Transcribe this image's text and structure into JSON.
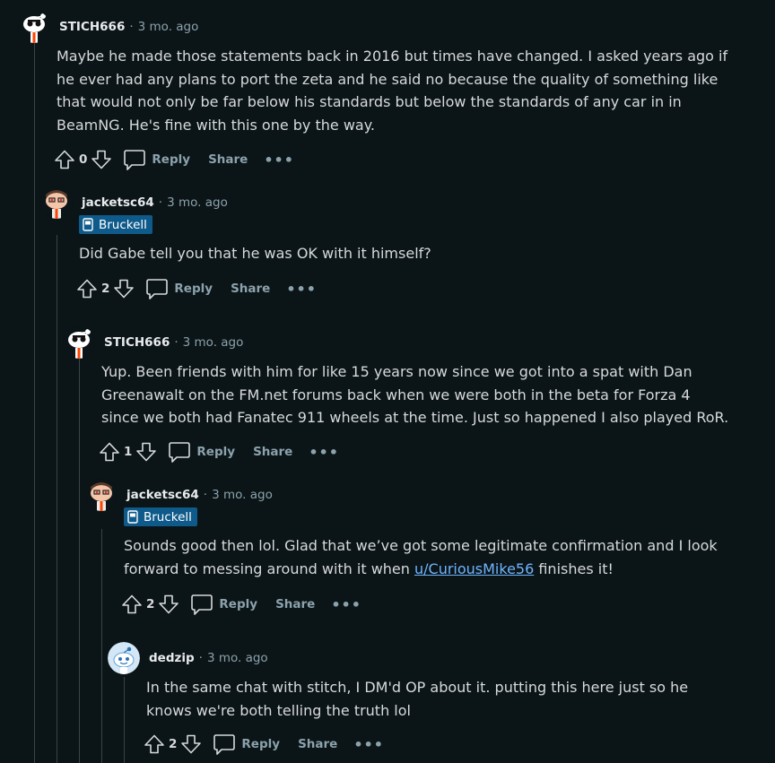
{
  "comments": [
    {
      "username": "STICH666",
      "time": "3 mo. ago",
      "flair": "",
      "body": "Maybe he made those statements back in 2016 but times have changed. I asked years ago if he ever had any plans to port the zeta and he said no because the quality of something like that would not only be far below his standards but below the standards of any car in in BeamNG. He's fine with this one by the way.",
      "score": "0"
    },
    {
      "username": "jacketsc64",
      "time": "3 mo. ago",
      "flair": "Bruckell",
      "body": "Did Gabe tell you that he was OK with it himself?",
      "score": "2"
    },
    {
      "username": "STICH666",
      "time": "3 mo. ago",
      "flair": "",
      "body": "Yup. Been friends with him for like 15 years now since we got into a spat with Dan Greenawalt on the FM.net forums back when we were both in the beta for Forza 4 since we both had Fanatec 911 wheels at the time. Just so happened I also played RoR.",
      "score": "1"
    },
    {
      "username": "jacketsc64",
      "time": "3 mo. ago",
      "flair": "Bruckell",
      "body_before": "Sounds good then lol. Glad that we’ve got some legitimate confirmation and I look forward to messing around with it when ",
      "body_link": "u/CuriousMike56",
      "body_after": " finishes it!",
      "score": "2"
    },
    {
      "username": "dedzip",
      "time": "3 mo. ago",
      "flair": "",
      "body": "In the same chat with stitch, I DM'd OP about it. putting this here just so he knows we're both telling the truth lol",
      "score": "2"
    }
  ],
  "actions": {
    "reply": "Reply",
    "share": "Share",
    "more": "•••",
    "separator": "·"
  },
  "colors": {
    "background": "#0b1416",
    "flair_bg": "#0e5a8a",
    "link": "#6fb5ff",
    "meta": "#8ba2ad"
  },
  "icons": [
    "snoo-avatar-icon",
    "upvote-icon",
    "downvote-icon",
    "comment-bubble-icon",
    "flair-car-icon",
    "more-options-icon"
  ]
}
